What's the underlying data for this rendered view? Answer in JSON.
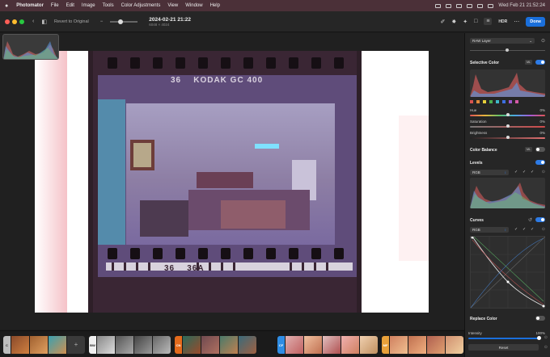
{
  "menubar": {
    "apple": "",
    "items": [
      "Photomator",
      "File",
      "Edit",
      "Image",
      "Tools",
      "Color Adjustments",
      "View",
      "Window",
      "Help"
    ],
    "clock": "Wed Feb 21 21:52:24"
  },
  "toolbar": {
    "revert_label": "Revert to Original",
    "doc_title": "2024-02-21 21:22",
    "doc_size": "6048 × 4024",
    "hdr_label": "HDR",
    "done_label": "Done"
  },
  "photo": {
    "edge_top": "36    KODAK GC 400",
    "edge_bottom": "36    36A",
    "colors": {
      "base": "#6b4d83",
      "room": "#8a8fc7",
      "border": "#3b2a3a",
      "accent": "#4bc2d8"
    }
  },
  "sidebar": {
    "raw_layer": "RAW Layer",
    "selective_color": {
      "title": "Selective Color",
      "ml": "ML",
      "on": true,
      "swatches": [
        "#d9534f",
        "#e08a3c",
        "#e6cf3a",
        "#4caf50",
        "#3fb8c9",
        "#3d6fe0",
        "#9b59d0",
        "#d65aa8"
      ],
      "hue": {
        "label": "Hue",
        "value": "0%",
        "pos": 0.5
      },
      "saturation": {
        "label": "Saturation",
        "value": "0%",
        "pos": 0.5
      },
      "brightness": {
        "label": "Brightness",
        "value": "0%",
        "pos": 0.5
      }
    },
    "color_balance": {
      "title": "Color Balance",
      "ml": "ML",
      "on": false
    },
    "levels": {
      "title": "Levels",
      "on": true,
      "channel": "RGB"
    },
    "curves": {
      "title": "Curves",
      "on": true,
      "channel": "RGB"
    },
    "replace_color": {
      "title": "Replace Color",
      "on": false
    },
    "intensity": {
      "label": "Intensity",
      "value": "100%",
      "fraction": 1.0
    },
    "reset_label": "Reset"
  },
  "filmstrip": {
    "groups": [
      {
        "tag": "C",
        "color": "#bdbdbd"
      },
      {
        "tag": "BW",
        "color": "#f0f0f0"
      },
      {
        "tag": "CN",
        "color": "#e36a1c"
      },
      {
        "tag": "CF",
        "color": "#2f8de4"
      },
      {
        "tag": "MF",
        "color": "#e8a13a"
      }
    ]
  }
}
